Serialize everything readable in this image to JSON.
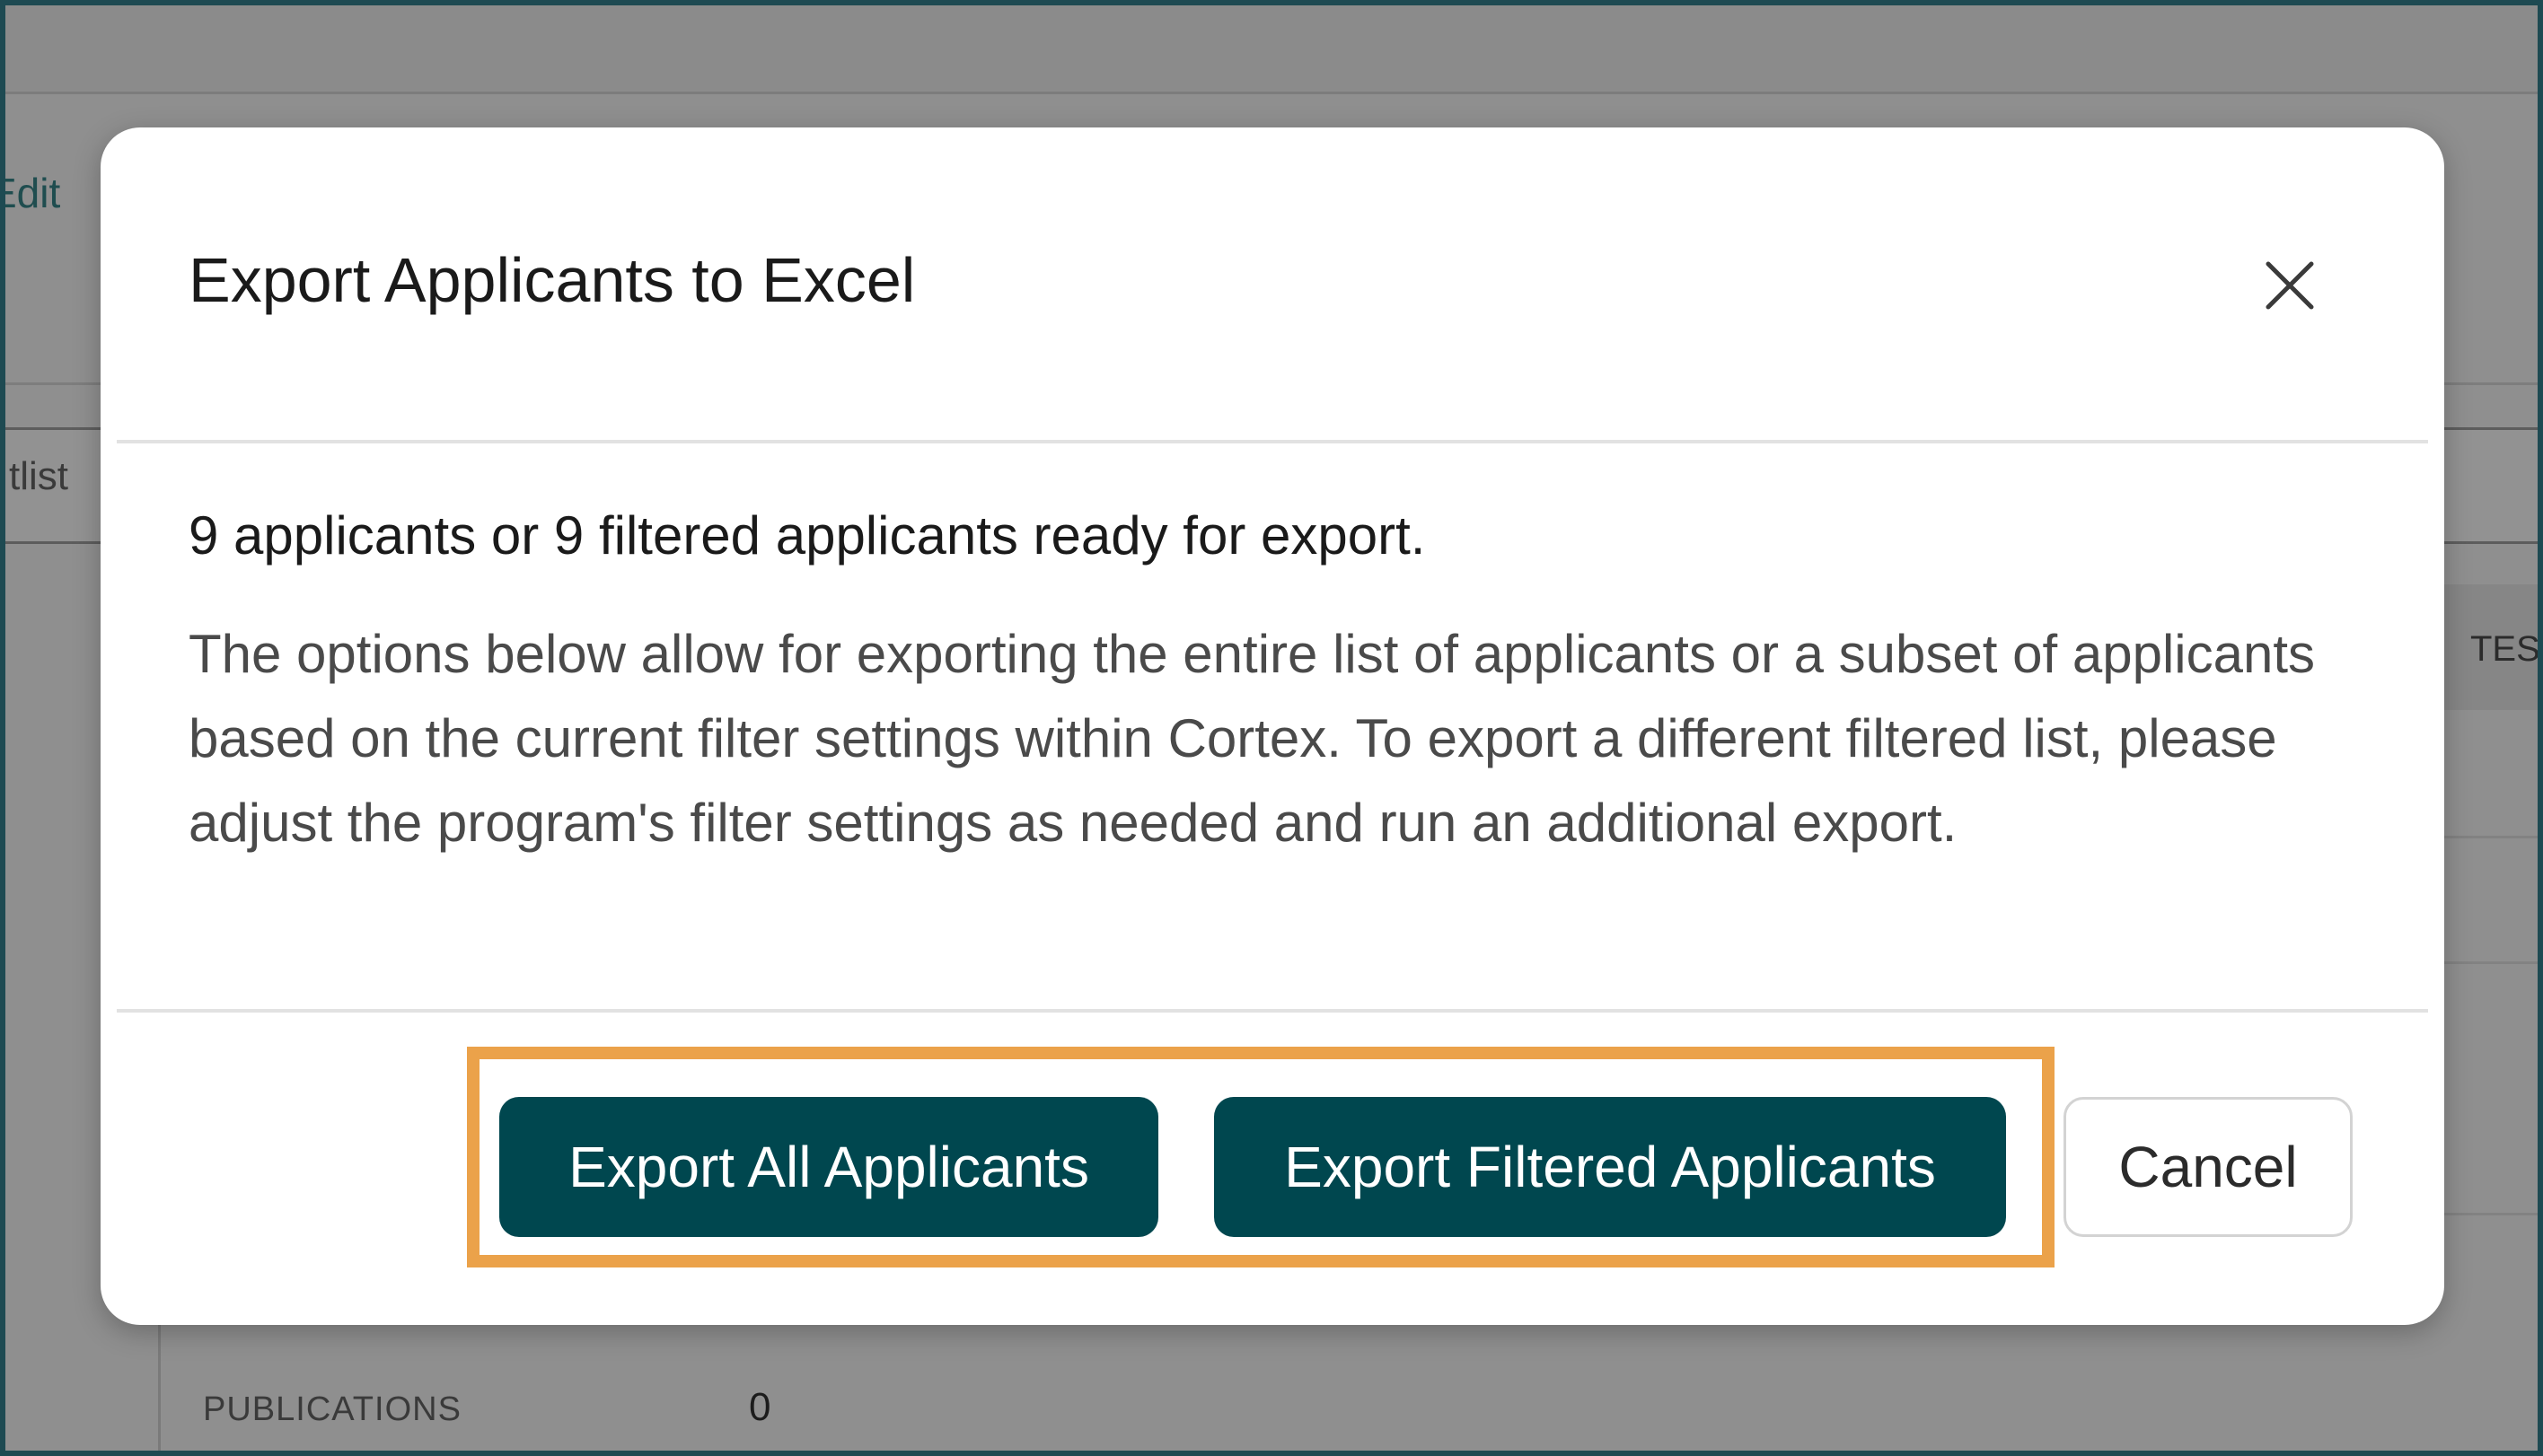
{
  "background": {
    "edit_link": "Edit",
    "tab_label": "tlist",
    "column_header_partial": "TES",
    "publications_label": "PUBLICATIONS",
    "publications_value": "0"
  },
  "modal": {
    "title": "Export Applicants to Excel",
    "close_icon": "close-icon",
    "summary": "9 applicants or 9 filtered applicants ready for export.",
    "description": "The options below allow for exporting the entire list of applicants or a subset of applicants based on the current filter settings within Cortex. To export a different filtered list, please adjust the program's filter settings as needed and run an additional export.",
    "buttons": {
      "export_all": "Export All Applicants",
      "export_filtered": "Export Filtered Applicants",
      "cancel": "Cancel"
    }
  },
  "colors": {
    "primary_button": "#00474f",
    "highlight": "#eba24a",
    "frame_border": "#1e4a52"
  }
}
